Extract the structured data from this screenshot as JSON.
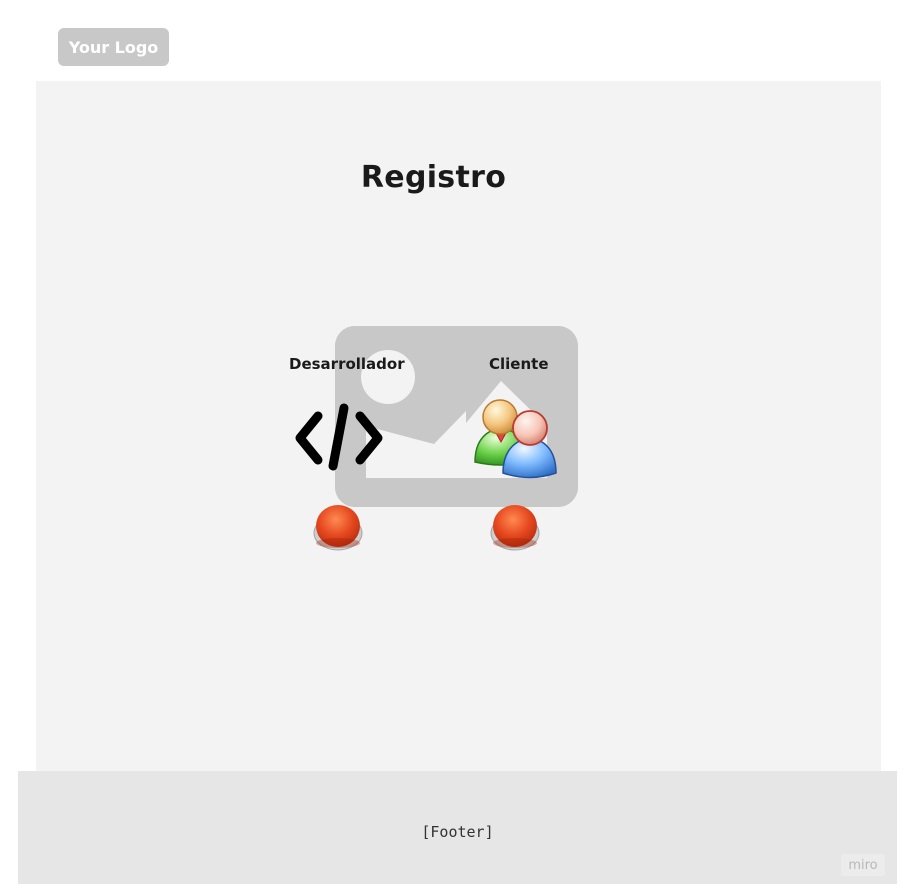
{
  "header": {
    "logo_text": "Your Logo"
  },
  "main": {
    "title": "Registro",
    "options": [
      {
        "label": "Desarrollador",
        "icon": "code-icon"
      },
      {
        "label": "Cliente",
        "icon": "users-icon"
      }
    ],
    "placeholder_icon": "image-placeholder-icon"
  },
  "footer": {
    "text": "[Footer]",
    "badge": "miro"
  },
  "colors": {
    "panel_background": "#f3f3f3",
    "placeholder_gray": "#c8c8c8",
    "footer_background": "#e6e6e6",
    "button_red": "#e0461f"
  }
}
